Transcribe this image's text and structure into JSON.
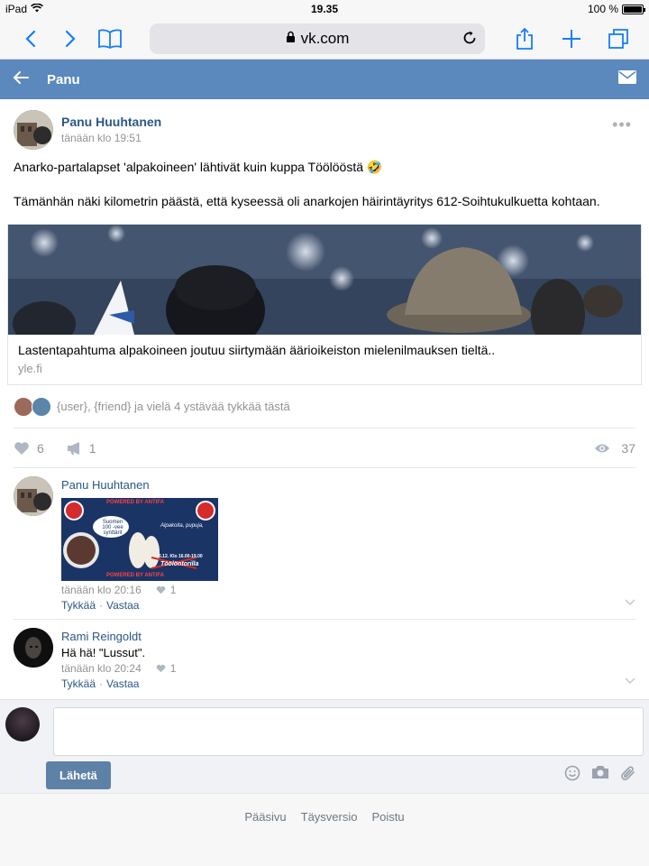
{
  "status_bar": {
    "device": "iPad",
    "time": "19.35",
    "battery": "100 %",
    "battery_level": 1.0
  },
  "browser": {
    "url": "vk.com",
    "icons": [
      "back-icon",
      "forward-icon",
      "bookmarks-icon",
      "lock-icon",
      "reload-icon",
      "share-icon",
      "new-tab-icon",
      "tabs-icon"
    ]
  },
  "header": {
    "title": "Panu",
    "icons": [
      "back-arrow-icon",
      "mail-icon"
    ]
  },
  "post": {
    "author": "Panu Huuhtanen",
    "date": "tänään klo 19:51",
    "text_line1": "Anarko-partalapset 'alpakoineen' lähtivät kuin kuppa Töölööstä 🤣",
    "text_line2": "Tämänhän näki kilometrin päästä, että kyseessä oli anarkojen häirintäyritys 612-Soihtukulkuetta kohtaan.",
    "link": {
      "title": "Lastentapahtuma alpakoineen joutuu siirtymään äärioikeiston mielenilmauksen tieltä..",
      "source": "yle.fi"
    },
    "likes_text": "{user}, {friend} ja vielä 4 ystävää tykkää tästä",
    "like_count": "6",
    "share_count": "1",
    "view_count": "37"
  },
  "comments": [
    {
      "author": "Panu Huuhtanen",
      "image_text": {
        "top": "POWERED BY ANTIFA",
        "bubble": "Suomen 100 -vee synttärit",
        "line1": "Alpakoita, pupuja,",
        "line2": "6.12. Klo 16.00-19.00",
        "line3": "Töölöntorilla",
        "bottom": "POWERED BY ANTIFA"
      },
      "date": "tänään klo 20:16",
      "likes": "1",
      "like_label": "Tykkää",
      "reply_label": "Vastaa"
    },
    {
      "author": "Rami Reingoldt",
      "text": "Hä hä! \"Lussut\".",
      "date": "tänään klo 20:24",
      "likes": "1",
      "like_label": "Tykkää",
      "reply_label": "Vastaa"
    }
  ],
  "composer": {
    "send_label": "Lähetä"
  },
  "footer": {
    "links": [
      "Pääsivu",
      "Täysversio",
      "Poistu"
    ]
  },
  "colors": {
    "header": "#5b88bd",
    "link": "#2a5885",
    "ios_blue": "#147efb",
    "muted": "#939393",
    "send_button": "#5e81a8"
  }
}
